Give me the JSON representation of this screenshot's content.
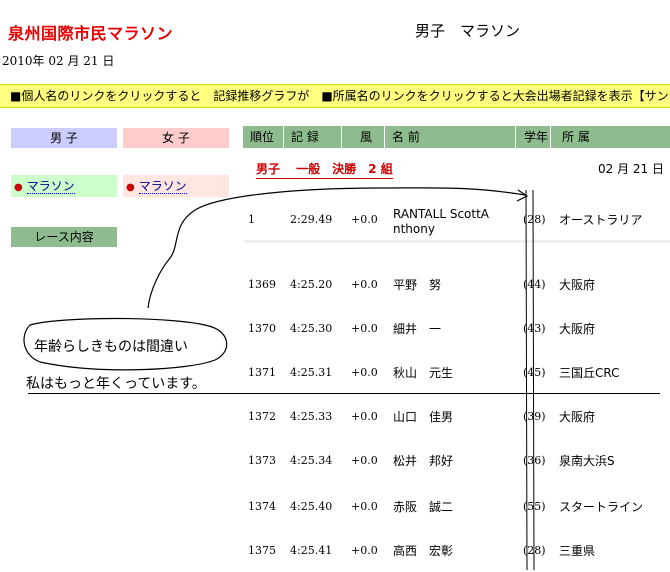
{
  "header": {
    "title": "泉州国際市民マラソン",
    "race_name": "男子　マラソン",
    "date": "2010年 02 月 21 日",
    "ticker": "■個人名のリンクをクリックすると　記録推移グラフが　■所属名のリンクをクリックすると大会出場者記録を表示【サンフ"
  },
  "sidebar": {
    "tab_male": "男 子",
    "tab_female": "女 子",
    "cat_male": "マラソン",
    "cat_female": "マラソン",
    "race_button": "レース内容"
  },
  "table": {
    "headers": [
      "順位",
      "記 録",
      "風",
      "名 前",
      "学年",
      "所 属"
    ],
    "section_title": "男子　 一般　決勝　2 組",
    "section_date": "02 月 21 日",
    "rows": [
      {
        "rank": "1",
        "time": "2:29.49",
        "wind": "+0.0",
        "name": "RANTALL ScottA",
        "name2": "nthony",
        "grade": "(28)",
        "org": "オーストラリア"
      },
      {
        "rank": "1369",
        "time": "4:25.20",
        "wind": "+0.0",
        "name": "平野　努",
        "name2": "",
        "grade": "(44)",
        "org": "大阪府"
      },
      {
        "rank": "1370",
        "time": "4:25.30",
        "wind": "+0.0",
        "name": "細井　一",
        "name2": "",
        "grade": "(43)",
        "org": "大阪府"
      },
      {
        "rank": "1371",
        "time": "4:25.31",
        "wind": "+0.0",
        "name": "秋山　元生",
        "name2": "",
        "grade": "(45)",
        "org": "三国丘CRC"
      },
      {
        "rank": "1372",
        "time": "4:25.33",
        "wind": "+0.0",
        "name": "山口　佳男",
        "name2": "",
        "grade": "(39)",
        "org": "大阪府"
      },
      {
        "rank": "1373",
        "time": "4:25.34",
        "wind": "+0.0",
        "name": "松井　邦好",
        "name2": "",
        "grade": "(36)",
        "org": "泉南大浜S"
      },
      {
        "rank": "1374",
        "time": "4:25.40",
        "wind": "+0.0",
        "name": "赤阪　誠二",
        "name2": "",
        "grade": "(55)",
        "org": "スタートライン"
      },
      {
        "rank": "1375",
        "time": "4:25.41",
        "wind": "+0.0",
        "name": "高西　宏彰",
        "name2": "",
        "grade": "(28)",
        "org": "三重県"
      }
    ]
  },
  "annotation": {
    "bubble": "年齢らしきものは間違い",
    "note": "私はもっと年くっています。"
  }
}
